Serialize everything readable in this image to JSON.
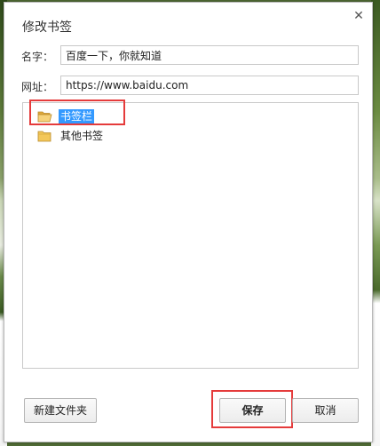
{
  "dialog": {
    "title": "修改书签",
    "close_icon": "close-icon"
  },
  "form": {
    "name_label": "名字：",
    "name_value": "百度一下，你就知道",
    "url_label": "网址：",
    "url_value": "https://www.baidu.com"
  },
  "tree": {
    "items": [
      {
        "label": "书签栏",
        "icon": "folder-open-icon",
        "selected": true
      },
      {
        "label": "其他书签",
        "icon": "folder-icon",
        "selected": false
      }
    ]
  },
  "buttons": {
    "new_folder": "新建文件夹",
    "save": "保存",
    "cancel": "取消"
  },
  "colors": {
    "selection": "#3399ff",
    "highlight_box": "#e53b3b",
    "folder": "#f3c75a"
  }
}
